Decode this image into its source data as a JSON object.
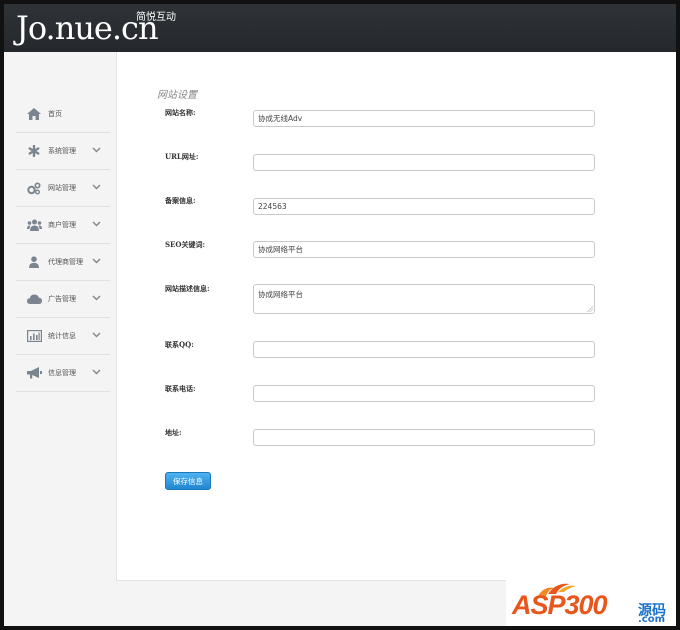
{
  "header": {
    "logo_text": "Jo.nue.cn",
    "logo_subtitle": "简悦互动"
  },
  "sidebar": {
    "items": [
      {
        "label": "首页",
        "icon": "home-icon",
        "has_chevron": false
      },
      {
        "label": "系统管理",
        "icon": "asterisk-icon",
        "has_chevron": true
      },
      {
        "label": "网站管理",
        "icon": "gears-icon",
        "has_chevron": true
      },
      {
        "label": "商户管理",
        "icon": "users-icon",
        "has_chevron": true
      },
      {
        "label": "代理商管理",
        "icon": "user-icon",
        "has_chevron": true
      },
      {
        "label": "广告管理",
        "icon": "cloud-icon",
        "has_chevron": true
      },
      {
        "label": "统计信息",
        "icon": "bar-chart-icon",
        "has_chevron": true
      },
      {
        "label": "信息管理",
        "icon": "megaphone-icon",
        "has_chevron": true
      }
    ]
  },
  "main": {
    "section_title": "网站设置",
    "fields": [
      {
        "label": "网站名称:",
        "value": "协成无线Adv",
        "type": "input"
      },
      {
        "label": "URL网址:",
        "value": "",
        "type": "input"
      },
      {
        "label": "备案信息:",
        "value": "224563",
        "type": "input"
      },
      {
        "label": "SEO关键词:",
        "value": "协成网络平台",
        "type": "input"
      },
      {
        "label": "网站描述信息:",
        "value": "协成网络平台",
        "type": "textarea"
      },
      {
        "label": "联系QQ:",
        "value": "",
        "type": "input"
      },
      {
        "label": "联系电话:",
        "value": "",
        "type": "input"
      },
      {
        "label": "地址:",
        "value": "",
        "type": "input"
      }
    ],
    "save_label": "保存信息"
  },
  "watermark": {
    "brand": "ASP300",
    "cn": "源码",
    "com": ".com"
  },
  "colors": {
    "header_bg": "#2a2e33",
    "button_bg": "#2a95e0",
    "watermark_orange": "#e8561c",
    "watermark_blue": "#1d73c9"
  }
}
